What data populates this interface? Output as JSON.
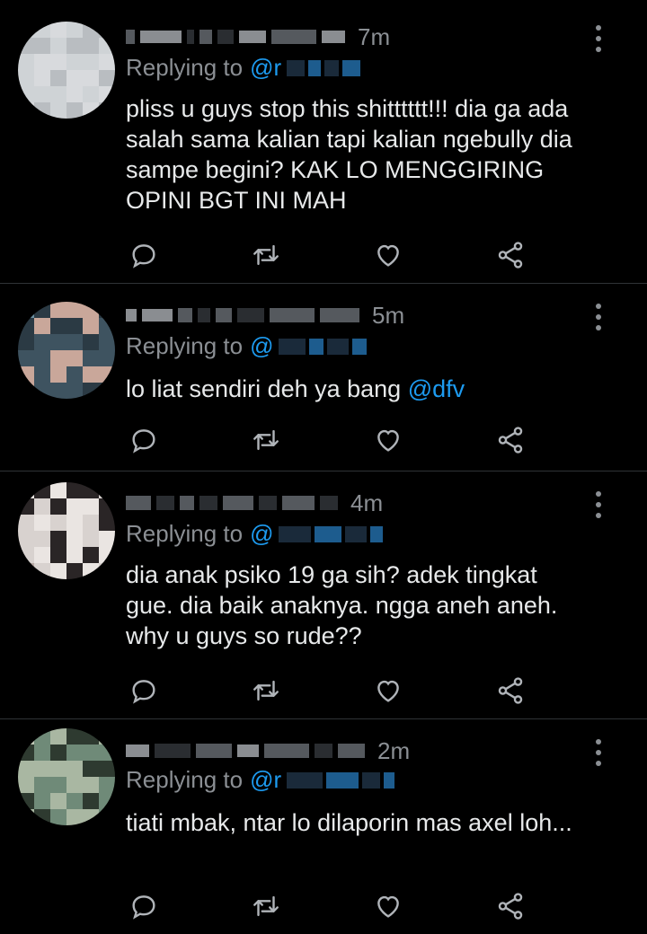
{
  "replies": [
    {
      "time": "7m",
      "replying_label": "Replying to",
      "handle_visible": "@r",
      "text": "pliss u guys stop this shitttttt!!! dia ga ada salah sama kalian tapi kalian ngebully dia sampe begini? KAK LO MENGGIRING OPINI BGT INI MAH",
      "mention": "",
      "avatar_palette": [
        "#cfd3d6",
        "#e4e6e8",
        "#b9bdc1",
        "#7e8286",
        "#d8dadd",
        "#9da1a5"
      ]
    },
    {
      "time": "5m",
      "replying_label": "Replying to",
      "handle_visible": "@",
      "text": "lo liat sendiri deh ya bang ",
      "mention": "@dfv",
      "avatar_palette": [
        "#2b3a44",
        "#6b8fa0",
        "#c9a79a",
        "#e0b5b4",
        "#3e5360",
        "#1b5fa0"
      ]
    },
    {
      "time": "4m",
      "replying_label": "Replying to",
      "handle_visible": "@",
      "text": "dia anak psiko 19 ga sih? adek tingkat gue. dia baik anaknya. ngga aneh aneh. why u guys so rude??",
      "mention": "",
      "avatar_palette": [
        "#d8d2cf",
        "#b9aaa5",
        "#2a2526",
        "#5b5253",
        "#eae5e2",
        "#8f8684"
      ]
    },
    {
      "time": "2m",
      "replying_label": "Replying to",
      "handle_visible": "@r",
      "text": "tiati mbak, ntar lo dilaporin mas axel loh...",
      "mention": "",
      "avatar_palette": [
        "#6f8a78",
        "#3d4a3c",
        "#a9b7a2",
        "#8b7a5e",
        "#2e3a30",
        "#c1c9b8"
      ]
    }
  ],
  "icons": {
    "reply": "reply-icon",
    "retweet": "retweet-icon",
    "like": "heart-icon",
    "share": "share-icon",
    "more": "more-vertical-icon"
  },
  "colors": {
    "background": "#000000",
    "text": "#e7e9ea",
    "muted": "#8b8f94",
    "accent": "#1d9bf0",
    "divider": "#2f3336"
  }
}
